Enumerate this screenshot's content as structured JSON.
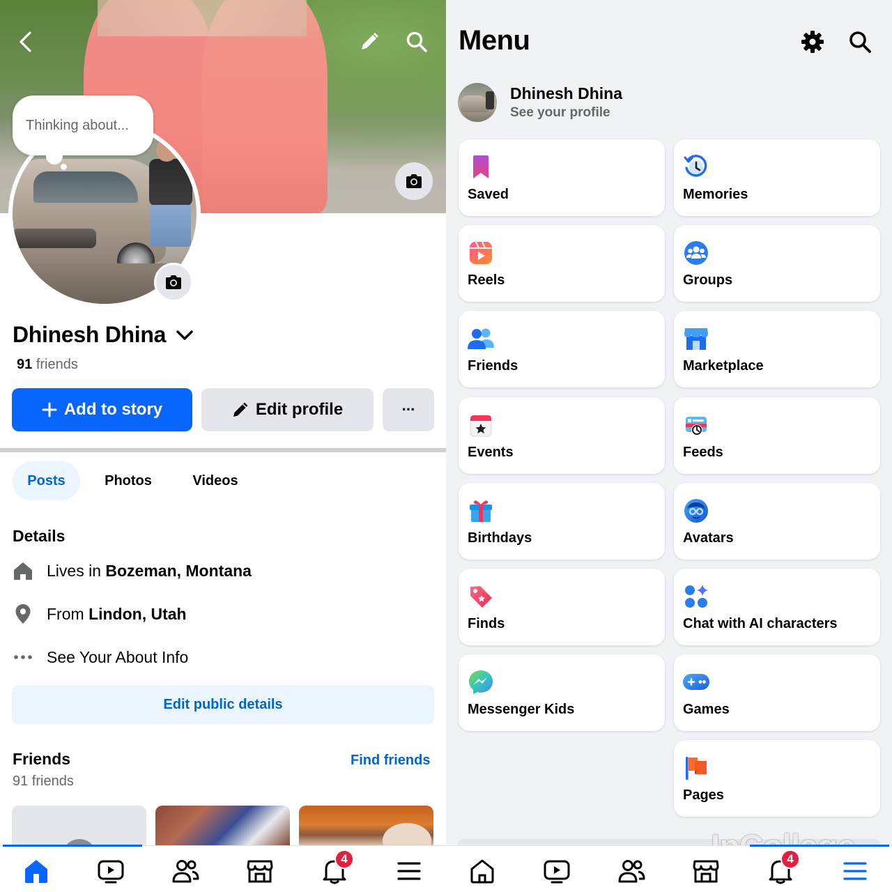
{
  "profile": {
    "name": "Dhinesh Dhina",
    "friends_count": "91",
    "friends_word": "friends",
    "thought_placeholder": "Thinking about..."
  },
  "actions": {
    "add_story": "Add to story",
    "edit_profile": "Edit profile",
    "more": "···"
  },
  "tabs": [
    {
      "label": "Posts",
      "active": true
    },
    {
      "label": "Photos",
      "active": false
    },
    {
      "label": "Videos",
      "active": false
    }
  ],
  "details": {
    "heading": "Details",
    "lives_prefix": "Lives in ",
    "lives_place": "Bozeman, Montana",
    "from_prefix": "From ",
    "from_place": "Lindon, Utah",
    "about": "See Your About Info",
    "edit_public": "Edit public details"
  },
  "friends_section": {
    "heading": "Friends",
    "count_label": "91 friends",
    "find_friends": "Find friends"
  },
  "left_nav": {
    "items": [
      "home-icon",
      "video-icon",
      "friends-icon",
      "marketplace-icon",
      "notifications-icon",
      "menu-icon"
    ],
    "active": "home-icon",
    "notification_badge": "4"
  },
  "menu": {
    "title": "Menu",
    "profile_name": "Dhinesh Dhina",
    "profile_sub": "See your profile",
    "left_column": [
      {
        "label": "Saved",
        "icon": "saved-icon"
      },
      {
        "label": "Reels",
        "icon": "reels-icon"
      },
      {
        "label": "Friends",
        "icon": "friends-icon"
      },
      {
        "label": "Events",
        "icon": "events-icon"
      },
      {
        "label": "Birthdays",
        "icon": "birthdays-icon"
      },
      {
        "label": "Finds",
        "icon": "finds-icon"
      },
      {
        "label": "Messenger Kids",
        "icon": "messenger-kids-icon"
      }
    ],
    "right_column": [
      {
        "label": "Memories",
        "icon": "memories-icon"
      },
      {
        "label": "Groups",
        "icon": "groups-icon"
      },
      {
        "label": "Marketplace",
        "icon": "marketplace-icon"
      },
      {
        "label": "Feeds",
        "icon": "feeds-icon"
      },
      {
        "label": "Avatars",
        "icon": "avatars-icon"
      },
      {
        "label": "Chat with AI characters",
        "icon": "ai-chat-icon"
      },
      {
        "label": "Games",
        "icon": "games-icon"
      },
      {
        "label": "Pages",
        "icon": "pages-icon"
      }
    ]
  },
  "right_nav": {
    "items": [
      "home-icon",
      "video-icon",
      "friends-icon",
      "marketplace-icon",
      "notifications-icon",
      "menu-icon"
    ],
    "active": "menu-icon",
    "notification_badge": "4"
  },
  "watermark": "InCollage",
  "colors": {
    "accent": "#0866ff",
    "accent_text": "#0064d1",
    "badge": "#e41e3f",
    "grey_button": "#e4e6eb",
    "panel_bg": "#f0f2f5"
  }
}
